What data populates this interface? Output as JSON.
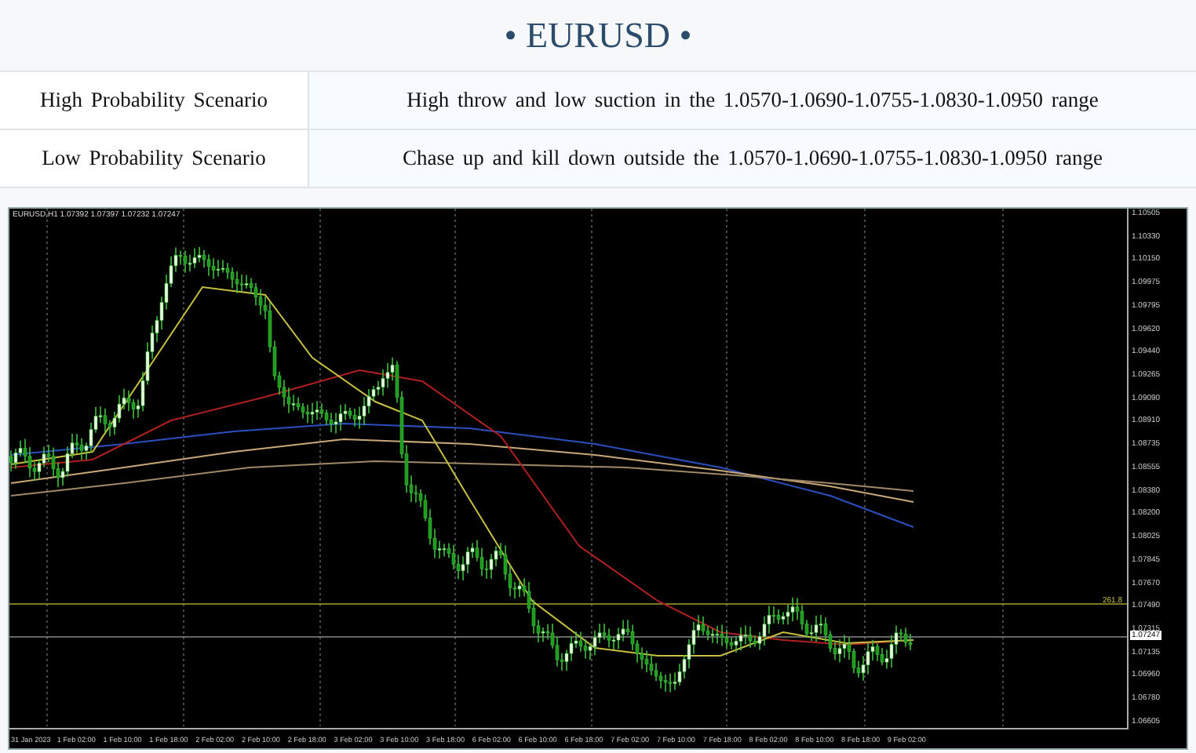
{
  "title": "• EURUSD •",
  "scenarios": [
    {
      "label": "High Probability Scenario",
      "text": "High throw and low suction in the 1.0570-1.0690-1.0755-1.0830-1.0950 range"
    },
    {
      "label": "Low Probability Scenario",
      "text": "Chase up and kill down outside the 1.0570-1.0690-1.0755-1.0830-1.0950 range"
    }
  ],
  "chart": {
    "header": "EURUSD,H1  1.07392 1.07397 1.07232 1.07247",
    "price_labels": [
      "1.10505",
      "1.10330",
      "1.10150",
      "1.09975",
      "1.09795",
      "1.09620",
      "1.09440",
      "1.09265",
      "1.09090",
      "1.08910",
      "1.08735",
      "1.08555",
      "1.08380",
      "1.08200",
      "1.08025",
      "1.07845",
      "1.07670",
      "1.07490",
      "1.07315",
      "1.07135",
      "1.06960",
      "1.06780",
      "1.06605"
    ],
    "current_price": "1.07247",
    "level_label": "261.8",
    "time_labels": [
      "31 Jan 2023",
      "1 Feb 02:00",
      "1 Feb 10:00",
      "1 Feb 18:00",
      "2 Feb 02:00",
      "2 Feb 10:00",
      "2 Feb 18:00",
      "3 Feb 02:00",
      "3 Feb 10:00",
      "3 Feb 18:00",
      "6 Feb 02:00",
      "6 Feb 10:00",
      "6 Feb 18:00",
      "7 Feb 02:00",
      "7 Feb 10:00",
      "7 Feb 18:00",
      "8 Feb 02:00",
      "8 Feb 10:00",
      "8 Feb 18:00",
      "9 Feb 02:00"
    ]
  }
}
